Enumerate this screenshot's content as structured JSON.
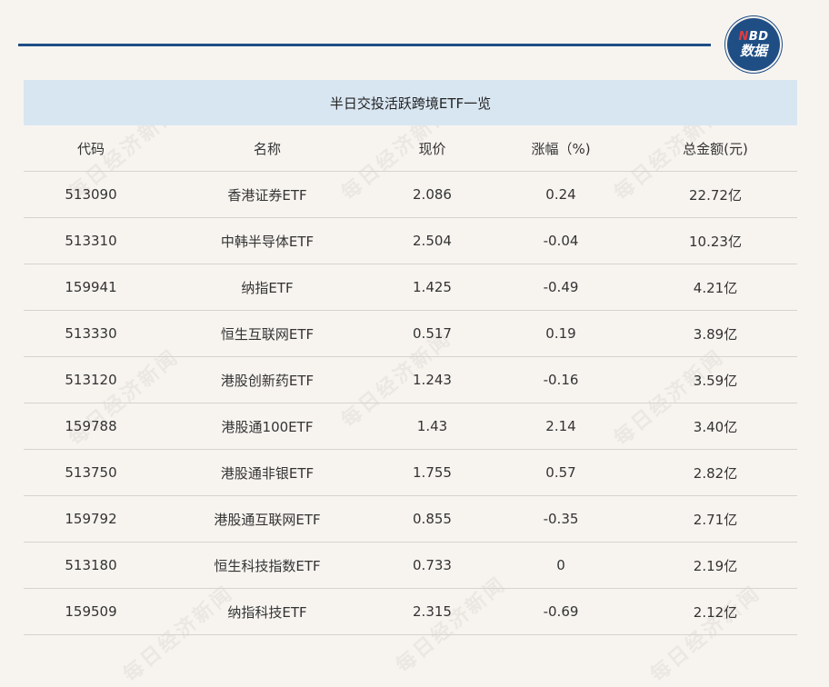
{
  "logo": {
    "line1_n": "N",
    "line1_rest": "BD",
    "line2": "数据"
  },
  "watermark_text": "每日经济新闻",
  "table": {
    "title": "半日交投活跃跨境ETF一览",
    "headers": [
      "代码",
      "名称",
      "现价",
      "涨幅（%)",
      "总金额(元)"
    ],
    "rows": [
      [
        "513090",
        "香港证券ETF",
        "2.086",
        "0.24",
        "22.72亿"
      ],
      [
        "513310",
        "中韩半导体ETF",
        "2.504",
        "-0.04",
        "10.23亿"
      ],
      [
        "159941",
        "纳指ETF",
        "1.425",
        "-0.49",
        "4.21亿"
      ],
      [
        "513330",
        "恒生互联网ETF",
        "0.517",
        "0.19",
        "3.89亿"
      ],
      [
        "513120",
        "港股创新药ETF",
        "1.243",
        "-0.16",
        "3.59亿"
      ],
      [
        "159788",
        "港股通100ETF",
        "1.43",
        "2.14",
        "3.40亿"
      ],
      [
        "513750",
        "港股通非银ETF",
        "1.755",
        "0.57",
        "2.82亿"
      ],
      [
        "159792",
        "港股通互联网ETF",
        "0.855",
        "-0.35",
        "2.71亿"
      ],
      [
        "513180",
        "恒生科技指数ETF",
        "0.733",
        "0",
        "2.19亿"
      ],
      [
        "159509",
        "纳指科技ETF",
        "2.315",
        "-0.69",
        "2.12亿"
      ]
    ]
  }
}
